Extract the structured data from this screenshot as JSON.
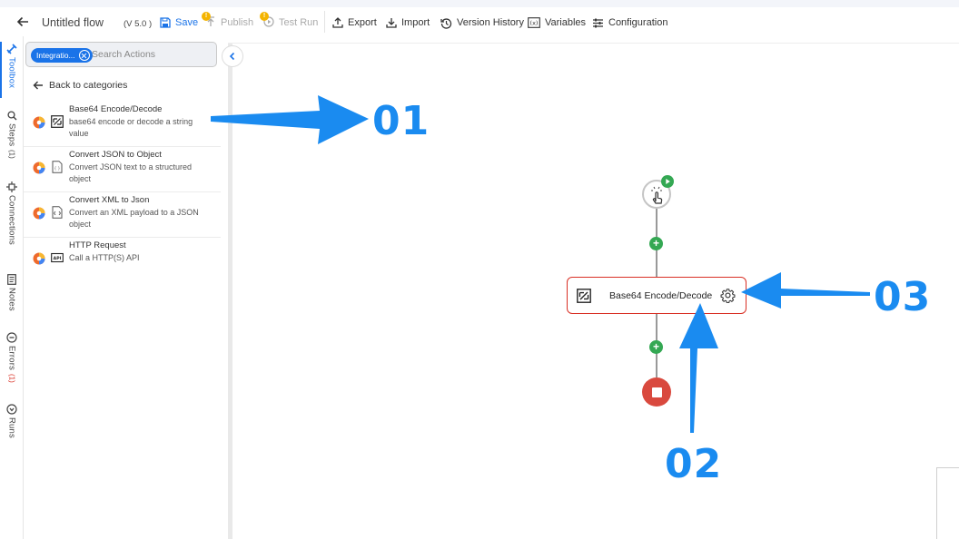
{
  "toolbar": {
    "title": "Untitled flow",
    "version": "(V 5.0 )",
    "save": "Save",
    "publish": "Publish",
    "test_run": "Test Run",
    "export": "Export",
    "import": "Import",
    "version_history": "Version History",
    "variables": "Variables",
    "configuration": "Configuration",
    "warning_badge": "!"
  },
  "rail": {
    "toolbox": "Toolbox",
    "steps": "Steps",
    "steps_count": "(1)",
    "connections": "Connections",
    "notes": "Notes",
    "errors": "Errors",
    "errors_count": "(1)",
    "runs": "Runs"
  },
  "panel": {
    "chip": "Integratio...",
    "search_placeholder": "Search Actions",
    "back": "Back to categories",
    "actions": [
      {
        "name": "Base64 Encode/Decode",
        "desc": "base64 encode or decode a string value"
      },
      {
        "name": "Convert JSON to Object",
        "desc": "Convert JSON text to a structured object"
      },
      {
        "name": "Convert XML to Json",
        "desc": "Convert an XML payload to a JSON object"
      },
      {
        "name": "HTTP Request",
        "desc": "Call a HTTP(S) API"
      }
    ]
  },
  "canvas": {
    "step_name": "Base64 Encode/Decode",
    "add": "+"
  },
  "annotations": {
    "c01": "01",
    "c02": "02",
    "c03": "03"
  },
  "colors": {
    "accent": "#1a73e8",
    "callout": "#1a8bf0",
    "error": "#d93025",
    "success": "#34a853"
  },
  "icons": [
    "back-arrow-icon",
    "save-icon",
    "publish-icon",
    "play-circle-icon",
    "export-icon",
    "import-icon",
    "history-icon",
    "variables-icon",
    "sliders-icon",
    "toolbox-icon",
    "search-icon",
    "connections-icon",
    "notes-icon",
    "error-icon",
    "runs-icon",
    "gear-icon",
    "hand-pointer-icon",
    "stop-icon"
  ]
}
